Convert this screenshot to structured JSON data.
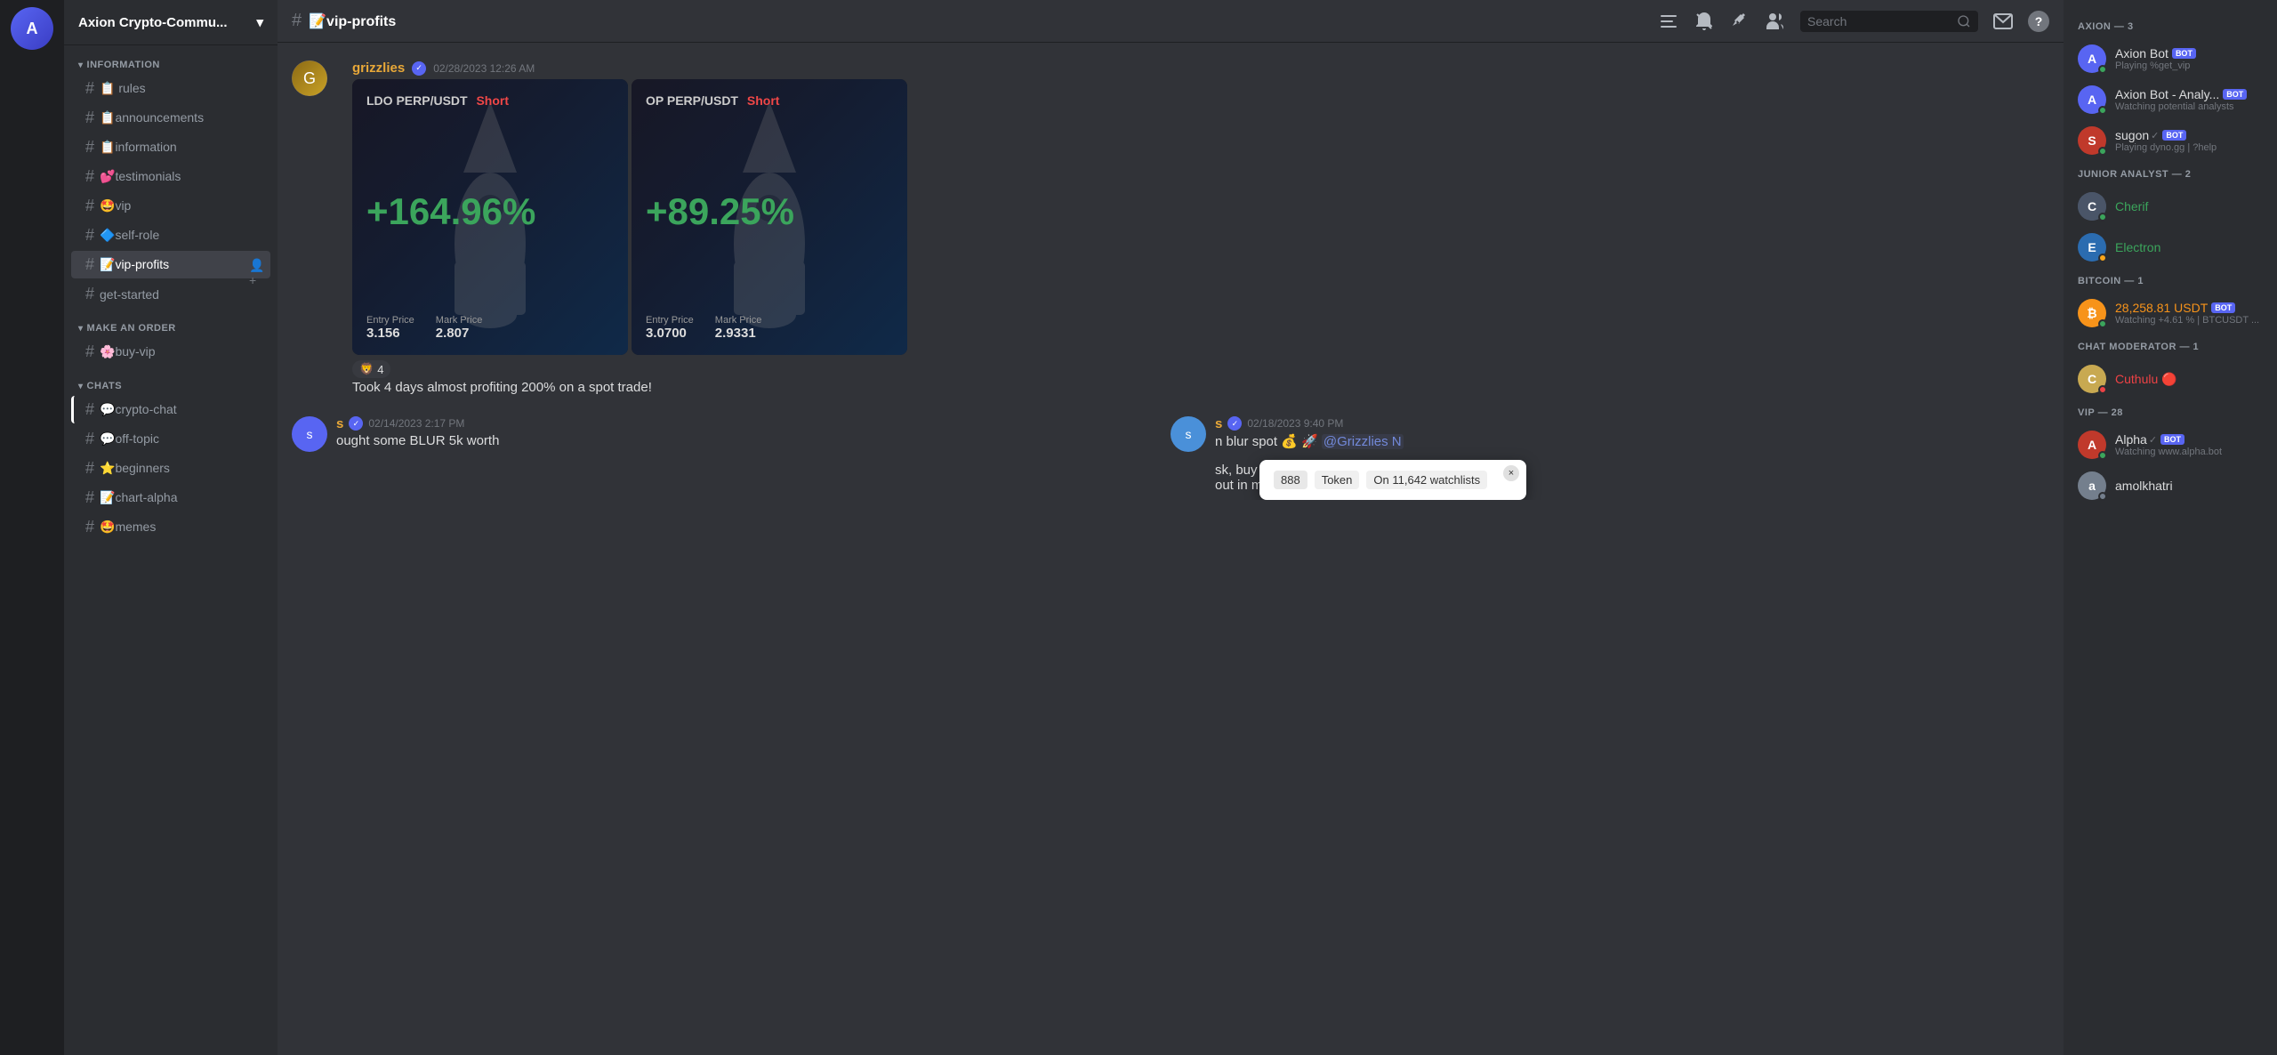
{
  "server": {
    "name": "Axion Crypto-Commu...",
    "icon": "A",
    "chevron": "▾"
  },
  "channels": {
    "information_section": "INFORMATION",
    "make_order_section": "MAKE AN ORDER",
    "chats_section": "CHATS",
    "items": [
      {
        "id": "rules",
        "name": "rules",
        "emoji": "📋",
        "hash": "#"
      },
      {
        "id": "announcements",
        "name": "📋announcements",
        "emoji": "",
        "hash": "#"
      },
      {
        "id": "information",
        "name": "📋information",
        "emoji": "",
        "hash": "#"
      },
      {
        "id": "testimonials",
        "name": "💕testimonials",
        "emoji": "",
        "hash": "#"
      },
      {
        "id": "vip",
        "name": "🤩vip",
        "emoji": "",
        "hash": "#"
      },
      {
        "id": "self-role",
        "name": "🔷self-role",
        "emoji": "",
        "hash": "#"
      },
      {
        "id": "vip-profits",
        "name": "📝vip-profits",
        "emoji": "",
        "hash": "#",
        "active": true
      },
      {
        "id": "get-started",
        "name": "get-started",
        "emoji": "",
        "hash": "#"
      },
      {
        "id": "buy-vip",
        "name": "🌸buy-vip",
        "emoji": "",
        "hash": "#"
      },
      {
        "id": "crypto-chat",
        "name": "💬crypto-chat",
        "emoji": "",
        "hash": "#"
      },
      {
        "id": "off-topic",
        "name": "💬off-topic",
        "emoji": "",
        "hash": "#"
      },
      {
        "id": "beginners",
        "name": "⭐beginners",
        "emoji": "",
        "hash": "#"
      },
      {
        "id": "chart-alpha",
        "name": "📝chart-alpha",
        "emoji": "",
        "hash": "#"
      },
      {
        "id": "memes",
        "name": "🤩memes",
        "emoji": "",
        "hash": "#"
      }
    ]
  },
  "header": {
    "channel_name": "📝vip-profits",
    "hash": "#",
    "actions": {
      "threads_icon": "≡",
      "notifications_icon": "🔔",
      "pinned_icon": "📌",
      "members_icon": "👤",
      "search_placeholder": "Search",
      "inbox_icon": "📥",
      "help_icon": "?"
    }
  },
  "messages": [
    {
      "id": "msg1",
      "author": "grizzlies",
      "verified": true,
      "timestamp": "02/28/2023 12:26 AM",
      "trade_cards": [
        {
          "pair": "LDO PERP/USDT",
          "direction": "Short",
          "profit": "+164.96%",
          "entry_price_label": "Entry Price",
          "entry_price": "3.156",
          "mark_price_label": "Mark Price",
          "mark_price": "2.807"
        },
        {
          "pair": "OP PERP/USDT",
          "direction": "Short",
          "profit": "+89.25%",
          "entry_price_label": "Entry Price",
          "entry_price": "3.0700",
          "mark_price_label": "Mark Price",
          "mark_price": "2.9331"
        }
      ],
      "reaction_emoji": "🦁",
      "reaction_count": "4",
      "text": "Took 4 days almost profiting 200% on a spot trade!"
    }
  ],
  "split_messages": {
    "left": {
      "author": "s",
      "verified": true,
      "timestamp": "02/14/2023 2:17 PM",
      "text": "ought some BLUR 5k worth"
    },
    "right": {
      "author": "s",
      "verified": true,
      "timestamp": "02/18/2023 9:40 PM",
      "text": "n blur spot 💰 🚀 @Grizzlies N"
    }
  },
  "token_popup": {
    "number": "888",
    "token_label": "Token",
    "watchlist_text": "On 11,642 watchlists",
    "close_icon": "×"
  },
  "members_sidebar": {
    "sections": [
      {
        "id": "axion",
        "label": "AXION — 3",
        "members": [
          {
            "name": "Axion Bot",
            "bot": true,
            "status": "online",
            "status_text": "Playing %get_vip",
            "color": "#5865f2",
            "initials": "A"
          },
          {
            "name": "Axion Bot - Analy...",
            "bot": true,
            "status": "online",
            "status_text": "Watching potential analysts",
            "color": "#5865f2",
            "initials": "A"
          },
          {
            "name": "sugon",
            "bot": true,
            "verified": true,
            "status": "online",
            "status_text": "Playing dyno.gg | ?help",
            "color": "#e03e2d",
            "initials": "S"
          }
        ]
      },
      {
        "id": "junior-analyst",
        "label": "JUNIOR ANALYST — 2",
        "members": [
          {
            "name": "Cherif",
            "bot": false,
            "status": "online",
            "status_text": "",
            "color": "#5865f2",
            "initials": "C",
            "name_color": "#3ba55c"
          },
          {
            "name": "Electron",
            "bot": false,
            "status": "idle",
            "status_text": "",
            "color": "#2b6cb0",
            "initials": "E",
            "name_color": "#3ba55c"
          }
        ]
      },
      {
        "id": "bitcoin",
        "label": "BITCOIN — 1",
        "members": [
          {
            "name": "28,258.81 USDT",
            "bot": true,
            "status": "online",
            "status_text": "Watching +4.61 % | BTCUSDT ...",
            "color": "#f7931a",
            "initials": "₿",
            "name_color": "#f7931a"
          }
        ]
      },
      {
        "id": "chat-moderator",
        "label": "CHAT MODERATOR — 1",
        "members": [
          {
            "name": "Cuthulu",
            "bot": false,
            "status": "dnd",
            "status_text": "",
            "color": "#c8a951",
            "initials": "C",
            "name_color": "#ed4245"
          }
        ]
      },
      {
        "id": "vip",
        "label": "VIP — 28",
        "members": [
          {
            "name": "Alpha",
            "bot": true,
            "verified": true,
            "status": "online",
            "status_text": "Watching www.alpha.bot",
            "color": "#e03e2d",
            "initials": "A",
            "name_color": "#dcddde"
          },
          {
            "name": "amolkhatri",
            "bot": false,
            "status": "offline",
            "status_text": "",
            "color": "#747f8d",
            "initials": "a",
            "name_color": "#dcddde"
          }
        ]
      }
    ]
  }
}
